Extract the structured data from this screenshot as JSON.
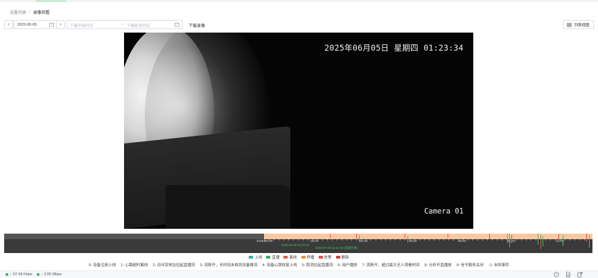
{
  "breadcrumb": {
    "parent": "设备列表",
    "separator": "/",
    "current": "录像回看"
  },
  "toolbar": {
    "prev_icon": "chevron-left-icon",
    "next_icon": "chevron-right-icon",
    "date_value": "2023-06-05",
    "range_start_placeholder": "下载开始时间",
    "range_separator": "→",
    "range_end_placeholder": "下载结束时间",
    "download_label": "下载录像",
    "list_view_label": "列表视图"
  },
  "video": {
    "osd_time": "2025年06月05日 星期四 01:23:34",
    "osd_camera": "Camera 01"
  },
  "timeline": {
    "date_label": "2025-06-05",
    "hour_labels": [
      "02:00",
      "04:00",
      "06:00",
      "08:00",
      "10:00",
      "12:00"
    ],
    "cursor_label_1": "2025-06-05 01:23:30",
    "cursor_label_2": "2025-06-05 04:12:23 (设备在线)",
    "colors": {
      "recording": "#f8c9a0",
      "online": "#3fbf67",
      "offline": "#e05a4f"
    }
  },
  "legend": [
    {
      "label": "上线",
      "color": "#29b3a8"
    },
    {
      "label": "直播",
      "color": "#2fb35d"
    },
    {
      "label": "离线",
      "color": "#e05a4f"
    },
    {
      "label": "停播",
      "color": "#f08a3c"
    },
    {
      "label": "告警",
      "color": "#e64a4a"
    },
    {
      "label": "删除",
      "color": "#d63a3a"
    }
  ],
  "event_codes": [
    "0: 设备注册上线",
    "1: 心跳超时离线",
    "2: 访问流地址拉起直播流",
    "3: 流断开，长时间未收到设备推流",
    "4: 设备心跳恢复上线",
    "5: 取消拉起直播流",
    "6: 用户播放",
    "7: 流断开，超过最大无人观看时间",
    "8: 分析开直播放",
    "9: 信令服务关闭",
    "-1: 未知事件"
  ],
  "status": {
    "upload_speed": "67.58 Kbps",
    "download_speed": "3.80 Mbps",
    "upload_icon": "arrow-up-icon",
    "download_icon": "arrow-down-icon",
    "right_icons": [
      "help-icon",
      "document-icon",
      "export-icon"
    ]
  }
}
